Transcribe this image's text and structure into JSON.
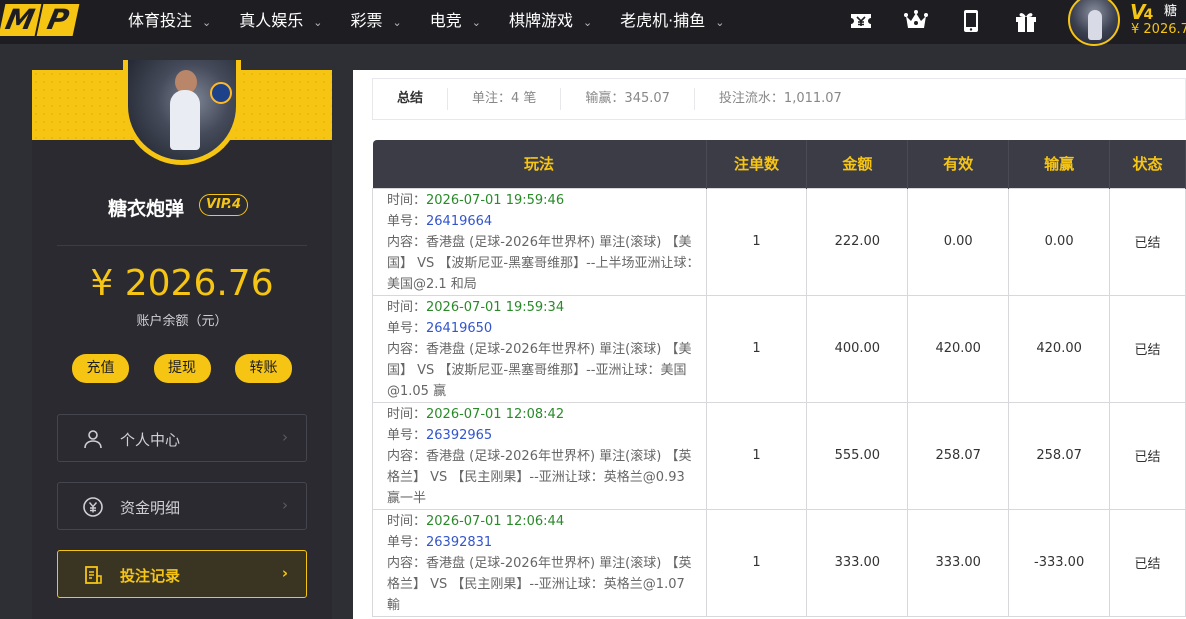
{
  "logo": {
    "letter1": "M",
    "letter2": "P"
  },
  "nav": [
    {
      "label": "体育投注"
    },
    {
      "label": "真人娱乐"
    },
    {
      "label": "彩票"
    },
    {
      "label": "电竞"
    },
    {
      "label": "棋牌游戏"
    },
    {
      "label": "老虎机·捕鱼"
    }
  ],
  "caret": "⌄",
  "top_icons": [
    "ticket-icon",
    "crown-icon",
    "tablet-icon",
    "gift-icon"
  ],
  "user_top": {
    "vip_prefix": "V",
    "vip_level": "4",
    "name_fragment": "糖",
    "balance": "¥ 2026.7"
  },
  "sidebar": {
    "name": "糖衣炮弹",
    "vip": "VIP.4",
    "balance": "¥ 2026.76",
    "balance_label": "账户余额（元）",
    "actions": [
      "充值",
      "提现",
      "转账"
    ],
    "menu": [
      {
        "label": "个人中心",
        "icon": "user-icon",
        "active": false
      },
      {
        "label": "资金明细",
        "icon": "yen-coin-icon",
        "active": false
      },
      {
        "label": "投注记录",
        "icon": "bet-record-icon",
        "active": true
      }
    ],
    "arrow": "›"
  },
  "summary": {
    "title": "总结",
    "bets": "单注：4 笔",
    "winloss": "输赢：345.07",
    "turnover": "投注流水：1,011.07"
  },
  "table": {
    "headers": [
      "玩法",
      "注单数",
      "金额",
      "有效",
      "输赢",
      "状态"
    ],
    "rows": [
      {
        "time_label": "时间：",
        "time": "2026-07-01 19:59:46",
        "no_label": "单号：",
        "no": "26419664",
        "content": "内容：香港盘 (足球-2026年世界杯) 單注(滚球) 【美国】 VS 【波斯尼亚-黑塞哥维那】--上半场亚洲让球：美国@2.1 和局",
        "count": "1",
        "amount": "222.00",
        "valid": "0.00",
        "winloss": "0.00",
        "result": "neutral",
        "status": "已结"
      },
      {
        "time_label": "时间：",
        "time": "2026-07-01 19:59:34",
        "no_label": "单号：",
        "no": "26419650",
        "content": "内容：香港盘 (足球-2026年世界杯) 單注(滚球) 【美国】 VS 【波斯尼亚-黑塞哥维那】--亚洲让球：美国@1.05 赢",
        "count": "1",
        "amount": "400.00",
        "valid": "420.00",
        "winloss": "420.00",
        "result": "win",
        "status": "已结"
      },
      {
        "time_label": "时间：",
        "time": "2026-07-01 12:08:42",
        "no_label": "单号：",
        "no": "26392965",
        "content": "内容：香港盘 (足球-2026年世界杯) 單注(滚球) 【英格兰】 VS 【民主刚果】--亚洲让球：英格兰@0.93 赢一半",
        "count": "1",
        "amount": "555.00",
        "valid": "258.07",
        "winloss": "258.07",
        "result": "win",
        "status": "已结"
      },
      {
        "time_label": "时间：",
        "time": "2026-07-01 12:06:44",
        "no_label": "单号：",
        "no": "26392831",
        "content": "内容：香港盘 (足球-2026年世界杯) 單注(滚球) 【英格兰】 VS 【民主刚果】--亚洲让球：英格兰@1.07 輸",
        "count": "1",
        "amount": "333.00",
        "valid": "333.00",
        "winloss": "-333.00",
        "result": "lose",
        "status": "已结"
      }
    ]
  }
}
